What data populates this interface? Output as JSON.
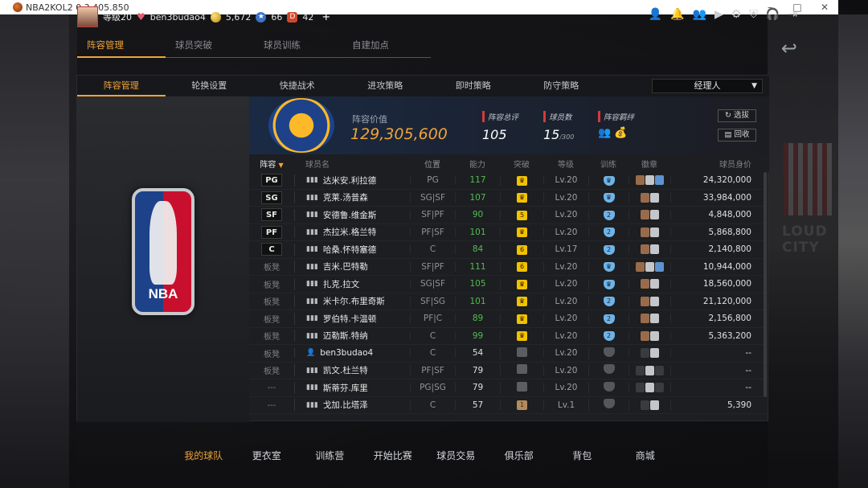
{
  "window": {
    "title": "NBA2KOL2 0.3.405.850"
  },
  "profile": {
    "level": "等级20",
    "username": "ben3budao4",
    "gold": "5,672",
    "stars": "66",
    "tokens": "42",
    "plus": "+"
  },
  "top_icons": [
    "user-icon",
    "bell-icon",
    "friends-icon",
    "video-icon",
    "gear-icon",
    "shield-icon",
    "headset-icon",
    "exit-icon"
  ],
  "main_tabs": [
    "阵容管理",
    "球员突破",
    "球员训练",
    "自建加点"
  ],
  "sub_tabs": [
    "阵容管理",
    "轮换设置",
    "快捷战术",
    "进攻策略",
    "即时策略",
    "防守策略"
  ],
  "manager_select": {
    "value": "经理人"
  },
  "summary": {
    "value_label": "阵容价值",
    "value": "129,305,600",
    "rating_label": "阵容总评",
    "rating": "105",
    "count_label": "球员数",
    "count": "15",
    "count_max": "/300",
    "bond_label": "阵容羁绊",
    "scout_btn": "选拔",
    "recycle_btn": "回收"
  },
  "table_headers": {
    "lineup": "阵容",
    "name": "球员名",
    "position": "位置",
    "ability": "能力",
    "breakthrough": "突破",
    "level": "等级",
    "training": "训练",
    "badges": "徽章",
    "value": "球员身价"
  },
  "players": [
    {
      "slot": "PG",
      "name": "达米安.利拉德",
      "pos": "PG",
      "ovr": "117",
      "brk": "♛",
      "lvl": "Lv.20",
      "trn": "♛",
      "badges": [
        "b",
        "s",
        "u"
      ],
      "value": "24,320,000"
    },
    {
      "slot": "SG",
      "name": "克莱.汤普森",
      "pos": "SG|SF",
      "ovr": "107",
      "brk": "♛",
      "lvl": "Lv.20",
      "trn": "♛",
      "badges": [
        "b",
        "s"
      ],
      "value": "33,984,000"
    },
    {
      "slot": "SF",
      "name": "安德鲁.维金斯",
      "pos": "SF|PF",
      "ovr": "90",
      "brk": "5",
      "lvl": "Lv.20",
      "trn": "2",
      "badges": [
        "b",
        "s"
      ],
      "value": "4,848,000"
    },
    {
      "slot": "PF",
      "name": "杰拉米.格兰特",
      "pos": "PF|SF",
      "ovr": "101",
      "brk": "♛",
      "lvl": "Lv.20",
      "trn": "2",
      "badges": [
        "b",
        "s"
      ],
      "value": "5,868,800"
    },
    {
      "slot": "C",
      "name": "哈桑.怀特塞德",
      "pos": "C",
      "ovr": "84",
      "brk": "6",
      "lvl": "Lv.17",
      "trn": "2",
      "badges": [
        "b",
        "s"
      ],
      "value": "2,140,800"
    },
    {
      "slot": "板凳",
      "name": "吉米.巴特勒",
      "pos": "SF|PF",
      "ovr": "111",
      "brk": "6",
      "lvl": "Lv.20",
      "trn": "♛",
      "badges": [
        "b",
        "s",
        "u"
      ],
      "value": "10,944,000"
    },
    {
      "slot": "板凳",
      "name": "扎克.拉文",
      "pos": "SG|SF",
      "ovr": "105",
      "brk": "♛",
      "lvl": "Lv.20",
      "trn": "♛",
      "badges": [
        "b",
        "s"
      ],
      "value": "18,560,000"
    },
    {
      "slot": "板凳",
      "name": "米卡尔.布里奇斯",
      "pos": "SF|SG",
      "ovr": "101",
      "brk": "♛",
      "lvl": "Lv.20",
      "trn": "2",
      "badges": [
        "b",
        "s"
      ],
      "value": "21,120,000"
    },
    {
      "slot": "板凳",
      "name": "罗伯特.卡温顿",
      "pos": "PF|C",
      "ovr": "89",
      "brk": "♛",
      "lvl": "Lv.20",
      "trn": "2",
      "badges": [
        "b",
        "s"
      ],
      "value": "2,156,800"
    },
    {
      "slot": "板凳",
      "name": "迈勒斯.特纳",
      "pos": "C",
      "ovr": "99",
      "brk": "♛",
      "lvl": "Lv.20",
      "trn": "2",
      "badges": [
        "b",
        "s"
      ],
      "value": "5,363,200"
    },
    {
      "slot": "板凳",
      "name": "ben3budao4",
      "pos": "C",
      "ovr": "54",
      "brk": "",
      "lvl": "Lv.20",
      "trn": "",
      "badges": [
        "d",
        "s"
      ],
      "value": "--",
      "self": true
    },
    {
      "slot": "板凳",
      "name": "凯文.杜兰特",
      "pos": "PF|SF",
      "ovr": "79",
      "brk": "",
      "lvl": "Lv.20",
      "trn": "",
      "badges": [
        "d",
        "s",
        "d"
      ],
      "value": "--"
    },
    {
      "slot": "---",
      "name": "斯蒂芬.库里",
      "pos": "PG|SG",
      "ovr": "79",
      "brk": "",
      "lvl": "Lv.20",
      "trn": "",
      "badges": [
        "d",
        "s",
        "d"
      ],
      "value": "--"
    },
    {
      "slot": "---",
      "name": "戈加.比塔泽",
      "pos": "C",
      "ovr": "57",
      "brk": "1",
      "lvl": "Lv.1",
      "trn": "",
      "badges": [
        "d",
        "s"
      ],
      "value": "5,390"
    }
  ],
  "bottom_nav": [
    "我的球队",
    "更衣室",
    "训练营",
    "开始比赛",
    "球员交易",
    "俱乐部",
    "背包",
    "商城"
  ]
}
